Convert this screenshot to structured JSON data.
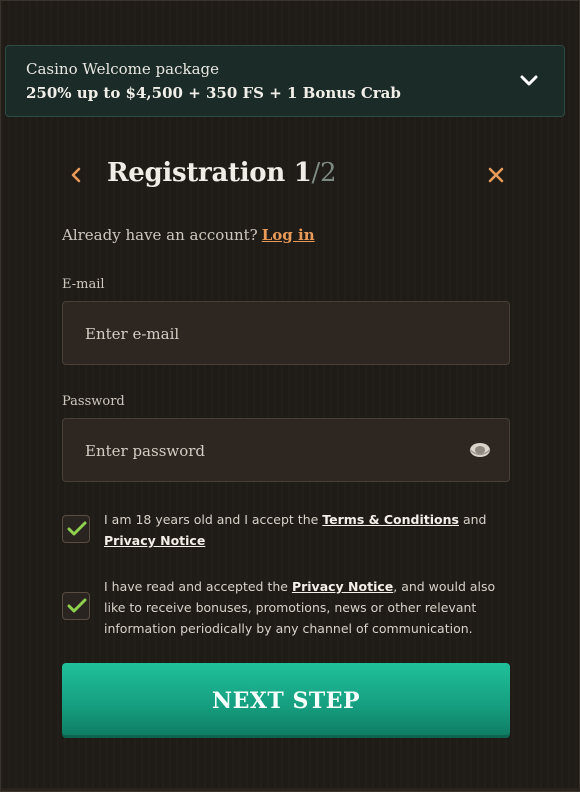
{
  "promo": {
    "title": "Casino Welcome package",
    "offer": "250% up to $4,500 + 350 FS + 1 Bonus Crab",
    "toggle_icon": "chevron-down-icon"
  },
  "header": {
    "title": "Registration",
    "step_current": "1",
    "step_total": "/2",
    "back_icon": "chevron-left-icon",
    "close_icon": "close-icon"
  },
  "login": {
    "prompt": "Already have an account?",
    "link_label": "Log in"
  },
  "email": {
    "label": "E-mail",
    "placeholder": "Enter e-mail",
    "value": ""
  },
  "password": {
    "label": "Password",
    "placeholder": "Enter password",
    "value": "",
    "toggle_icon": "eye-icon"
  },
  "consents": [
    {
      "checked": true,
      "text_1": "I am 18 years old and I accept the ",
      "link_1": "Terms & Conditions",
      "text_2": " and ",
      "link_2": "Privacy Notice"
    },
    {
      "checked": true,
      "text_1": "I have read and accepted the ",
      "link_1": "Privacy Notice",
      "text_2": ", and would also like to receive bonuses, promotions, news or other relevant information periodically by any channel of communication."
    }
  ],
  "next_button": {
    "label": "NEXT STEP"
  },
  "colors": {
    "accent_orange": "#e89a58",
    "accent_green": "#1fc09a",
    "check_green": "#8fd14f",
    "background": "#1f1b17"
  }
}
